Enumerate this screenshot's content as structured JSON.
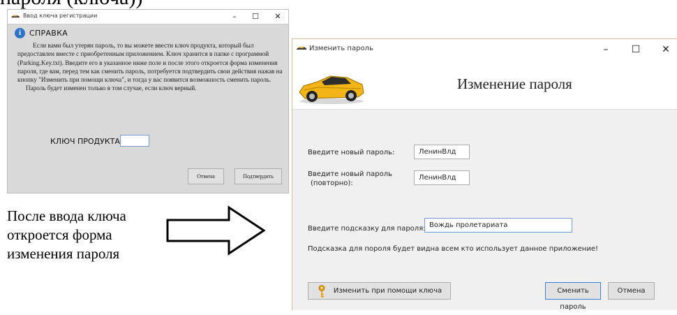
{
  "page": {
    "top_cut_text": "пароля (ключа))"
  },
  "key_window": {
    "title": "Ввод ключа регистрации",
    "help_title": "СПРАВКА",
    "help_paragraph_1": "Если вами был утерян пароль, то вы можете ввести ключ продукта, который был предоставлен вместе с приобретенным приложением. Ключ хранится в папке с программой (Parking.Key.txt). Введите его в указанное ниже поле и после этого откроется форма изменения пароля, где вам, перед тем как сменить пароль, потребуется подтвердить свои действия нажав на кнопку \"Изменить при помощи ключа\", и тогда у вас появится возможность сменить пароль.",
    "help_paragraph_2": "Пароль будет изменен только в том случае, если ключ верный.",
    "key_label": "КЛЮЧ ПРОДУКТА:",
    "key_value": "",
    "cancel_label": "Отмена",
    "confirm_label": "Подтвердить",
    "minimize": "–",
    "maximize": "☐",
    "close": "✕"
  },
  "caption": {
    "line1": "После ввода ключа",
    "line2": "откроется форма",
    "line3": "изменения пароля"
  },
  "password_window": {
    "title": "Изменить пароль",
    "header_title": "Изменение пароля",
    "new_password_label": "Введите новый пароль:",
    "new_password_value": "ЛенинВлд",
    "repeat_password_label_1": "Введите новый пароль",
    "repeat_password_label_2": "(повторно):",
    "repeat_password_value": "ЛенинВлд",
    "hint_label": "Введите подсказку для пароля:",
    "hint_value": "Вождь пролетариата",
    "hint_note": "Подсказка для пороля будет видна всем кто использует данное приложение!",
    "change_with_key_label": "Изменить при помощи ключа",
    "change_password_label": "Сменить пароль",
    "cancel_label": "Отмена",
    "minimize": "–",
    "maximize": "☐",
    "close": "✕"
  },
  "colors": {
    "accent_blue": "#3c7fd6",
    "car_yellow": "#f2b416"
  },
  "icons": {
    "app": "car-icon",
    "info": "info-icon",
    "key": "key-icon",
    "arrow": "arrow-right-icon"
  }
}
